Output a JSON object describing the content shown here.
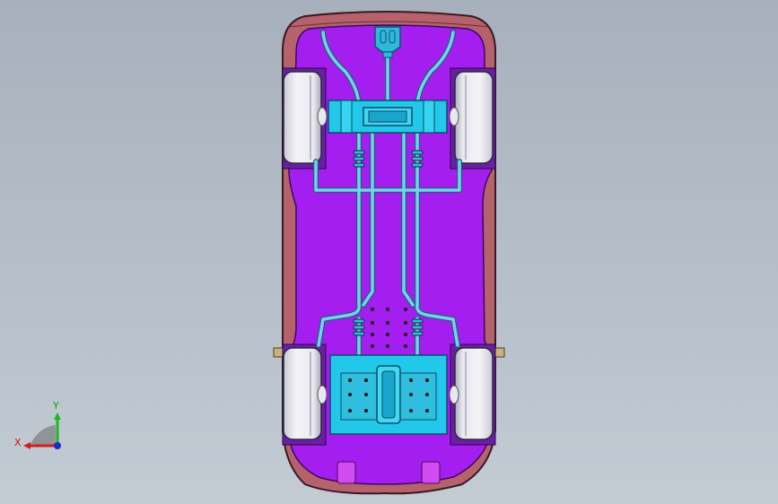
{
  "triad": {
    "x_label": "X",
    "y_label": "Y",
    "x_color": "#e01818",
    "y_color": "#18b818",
    "z_color": "#1a2ccc"
  },
  "colors": {
    "body": "#b8646e",
    "chassis": "#a020f0",
    "rails": "#6fc8e6",
    "rail_core": "#3aa9d8",
    "block": "#22d0ee",
    "tire": "#e6e6ee",
    "wheel_well": "#6a1aa0"
  }
}
